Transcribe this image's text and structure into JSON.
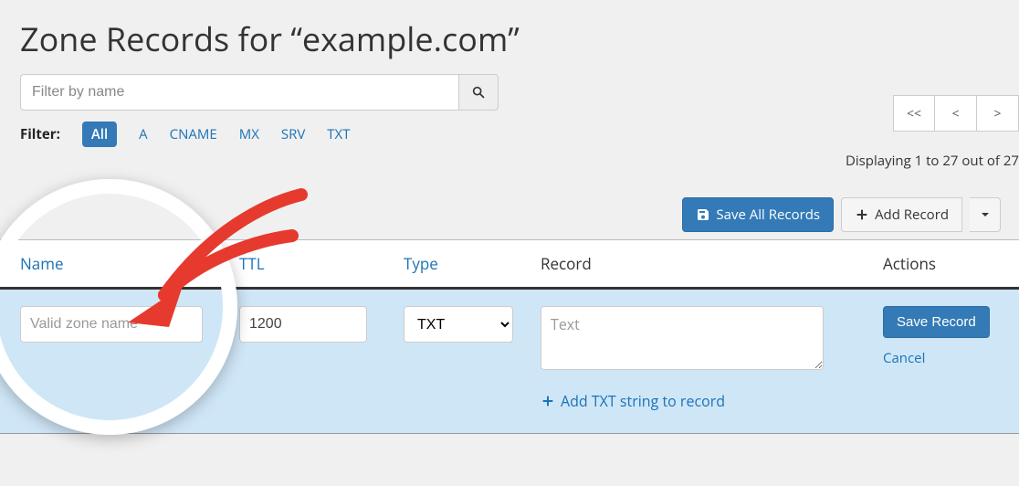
{
  "title": "Zone Records for “example.com”",
  "search": {
    "placeholder": "Filter by name"
  },
  "filter": {
    "label": "Filter:",
    "active": "All",
    "options": [
      "A",
      "CNAME",
      "MX",
      "SRV",
      "TXT"
    ]
  },
  "pager": {
    "first": "<<",
    "prev": "<",
    "next": ">"
  },
  "displaying": "Displaying 1 to 27 out of 27",
  "toolbar": {
    "save_all": "Save All Records",
    "add_record": "Add Record"
  },
  "columns": {
    "name": "Name",
    "ttl": "TTL",
    "type": "Type",
    "record": "Record",
    "actions": "Actions"
  },
  "row": {
    "name_placeholder": "Valid zone name",
    "ttl_value": "1200",
    "type_value": "TXT",
    "record_placeholder": "Text",
    "add_txt": "Add TXT string to record",
    "save": "Save Record",
    "cancel": "Cancel"
  }
}
